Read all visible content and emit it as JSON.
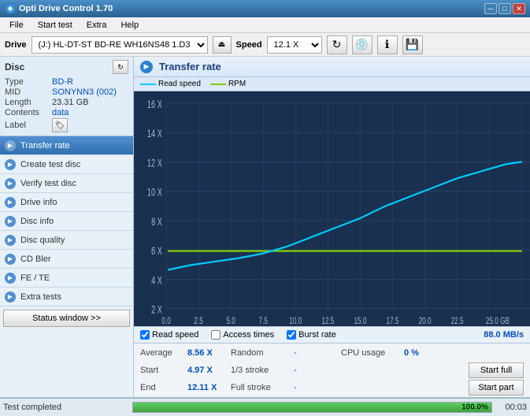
{
  "titlebar": {
    "title": "Opti Drive Control 1.70",
    "min_label": "─",
    "max_label": "□",
    "close_label": "✕"
  },
  "menubar": {
    "items": [
      "File",
      "Start test",
      "Extra",
      "Help"
    ]
  },
  "drivebar": {
    "drive_label": "Drive",
    "drive_value": "(J:)  HL-DT-ST BD-RE  WH16NS48 1.D3",
    "speed_label": "Speed",
    "speed_value": "12.1 X ▾"
  },
  "disc": {
    "title": "Disc",
    "type_label": "Type",
    "type_value": "BD-R",
    "mid_label": "MID",
    "mid_value": "SONYNN3 (002)",
    "length_label": "Length",
    "length_value": "23.31 GB",
    "contents_label": "Contents",
    "contents_value": "data",
    "label_label": "Label",
    "label_value": ""
  },
  "nav": {
    "items": [
      {
        "label": "Transfer rate",
        "active": true
      },
      {
        "label": "Create test disc",
        "active": false
      },
      {
        "label": "Verify test disc",
        "active": false
      },
      {
        "label": "Drive info",
        "active": false
      },
      {
        "label": "Disc info",
        "active": false
      },
      {
        "label": "Disc quality",
        "active": false
      },
      {
        "label": "CD Bler",
        "active": false
      },
      {
        "label": "FE / TE",
        "active": false
      },
      {
        "label": "Extra tests",
        "active": false
      }
    ],
    "status_window_btn": "Status window >>"
  },
  "chart": {
    "title": "Transfer rate",
    "legend": {
      "read_speed_label": "Read speed",
      "rpm_label": "RPM",
      "read_speed_color": "#00ccff",
      "rpm_color": "#80cc00"
    },
    "y_labels": [
      "16 X",
      "14 X",
      "12 X",
      "10 X",
      "8 X",
      "6 X",
      "4 X",
      "2 X"
    ],
    "x_labels": [
      "0.0",
      "2.5",
      "5.0",
      "7.5",
      "10.0",
      "12.5",
      "15.0",
      "17.5",
      "20.0",
      "22.5",
      "25.0 GB"
    ]
  },
  "checkboxes": {
    "read_speed_label": "Read speed",
    "read_speed_checked": true,
    "access_times_label": "Access times",
    "access_times_checked": false,
    "burst_rate_label": "Burst rate",
    "burst_rate_checked": true,
    "burst_rate_value": "88.0 MB/s"
  },
  "stats": {
    "average_label": "Average",
    "average_value": "8.56 X",
    "random_label": "Random",
    "random_value": "-",
    "cpu_usage_label": "CPU usage",
    "cpu_usage_value": "0 %",
    "start_label": "Start",
    "start_value": "4.97 X",
    "stroke_1_3_label": "1/3 stroke",
    "stroke_1_3_value": "-",
    "start_full_btn": "Start full",
    "end_label": "End",
    "end_value": "12.11 X",
    "full_stroke_label": "Full stroke",
    "full_stroke_value": "-",
    "start_part_btn": "Start part"
  },
  "statusbar": {
    "text": "Test completed",
    "progress": 100,
    "progress_label": "100.0%",
    "time": "00:03"
  }
}
